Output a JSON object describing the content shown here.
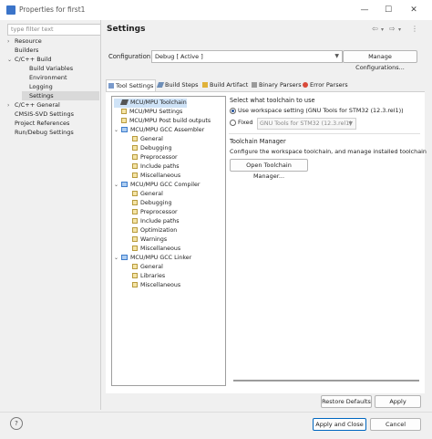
{
  "window": {
    "title": "Properties for first1",
    "icon": "ide-icon",
    "controls": {
      "minimize": "—",
      "maximize": "☐",
      "close": "✕"
    }
  },
  "left": {
    "filter_placeholder": "type filter text",
    "tree": [
      {
        "label": "Resource",
        "chevron": "›",
        "level": 0
      },
      {
        "label": "Builders",
        "chevron": "",
        "level": 0
      },
      {
        "label": "C/C++ Build",
        "chevron": "⌄",
        "level": 0
      },
      {
        "label": "Build Variables",
        "chevron": "",
        "level": 1
      },
      {
        "label": "Environment",
        "chevron": "",
        "level": 1
      },
      {
        "label": "Logging",
        "chevron": "",
        "level": 1
      },
      {
        "label": "Settings",
        "chevron": "",
        "level": 1,
        "selected": true
      },
      {
        "label": "C/C++ General",
        "chevron": "›",
        "level": 0
      },
      {
        "label": "CMSIS-SVD Settings",
        "chevron": "",
        "level": 0
      },
      {
        "label": "Project References",
        "chevron": "",
        "level": 0
      },
      {
        "label": "Run/Debug Settings",
        "chevron": "",
        "level": 0
      }
    ]
  },
  "header": {
    "title": "Settings",
    "nav_icons": [
      "⇦",
      "▾",
      "⇨",
      "▾",
      "⋮"
    ]
  },
  "configuration": {
    "label": "Configuration:",
    "value": "Debug  [ Active ]",
    "manage_button": "Manage Configurations..."
  },
  "tabs": [
    {
      "label": "Tool Settings",
      "active": true
    },
    {
      "label": "Build Steps"
    },
    {
      "label": "Build Artifact"
    },
    {
      "label": "Binary Parsers"
    },
    {
      "label": "Error Parsers"
    }
  ],
  "tool_tree": [
    {
      "label": "MCU/MPU Toolchain",
      "kind": "tool",
      "level": 0,
      "selected": true
    },
    {
      "label": "MCU/MPU Settings",
      "kind": "leaf",
      "level": 0
    },
    {
      "label": "MCU/MPU Post build outputs",
      "kind": "leaf",
      "level": 0
    },
    {
      "label": "MCU/MPU GCC Assembler",
      "kind": "folder",
      "level": 0,
      "chevron": "⌄"
    },
    {
      "label": "General",
      "kind": "leaf",
      "level": 1
    },
    {
      "label": "Debugging",
      "kind": "leaf",
      "level": 1
    },
    {
      "label": "Preprocessor",
      "kind": "leaf",
      "level": 1
    },
    {
      "label": "Include paths",
      "kind": "leaf",
      "level": 1
    },
    {
      "label": "Miscellaneous",
      "kind": "leaf",
      "level": 1
    },
    {
      "label": "MCU/MPU GCC Compiler",
      "kind": "folder",
      "level": 0,
      "chevron": "⌄"
    },
    {
      "label": "General",
      "kind": "leaf",
      "level": 1
    },
    {
      "label": "Debugging",
      "kind": "leaf",
      "level": 1
    },
    {
      "label": "Preprocessor",
      "kind": "leaf",
      "level": 1
    },
    {
      "label": "Include paths",
      "kind": "leaf",
      "level": 1
    },
    {
      "label": "Optimization",
      "kind": "leaf",
      "level": 1
    },
    {
      "label": "Warnings",
      "kind": "leaf",
      "level": 1
    },
    {
      "label": "Miscellaneous",
      "kind": "leaf",
      "level": 1
    },
    {
      "label": "MCU/MPU GCC Linker",
      "kind": "folder",
      "level": 0,
      "chevron": "⌄"
    },
    {
      "label": "General",
      "kind": "leaf",
      "level": 1
    },
    {
      "label": "Libraries",
      "kind": "leaf",
      "level": 1
    },
    {
      "label": "Miscellaneous",
      "kind": "leaf",
      "level": 1
    }
  ],
  "toolchain": {
    "select_label": "Select what toolchain to use",
    "workspace_option": "Use workspace setting (GNU Tools for STM32 (12.3.rel1))",
    "fixed_option": "Fixed",
    "fixed_value": "GNU Tools for STM32 (12.3.rel1)",
    "selected_option": "workspace",
    "manager_title": "Toolchain Manager",
    "manager_desc": "Configure the workspace toolchain, and manage installed toolchain",
    "manager_button": "Open Toolchain Manager..."
  },
  "footer": {
    "restore_defaults": "Restore Defaults",
    "apply": "Apply",
    "apply_close": "Apply and Close",
    "cancel": "Cancel",
    "help": "?"
  },
  "colors": {
    "selection": "#cfe3f7",
    "accent": "#0067c0",
    "window_bg": "#f0f0f0"
  }
}
